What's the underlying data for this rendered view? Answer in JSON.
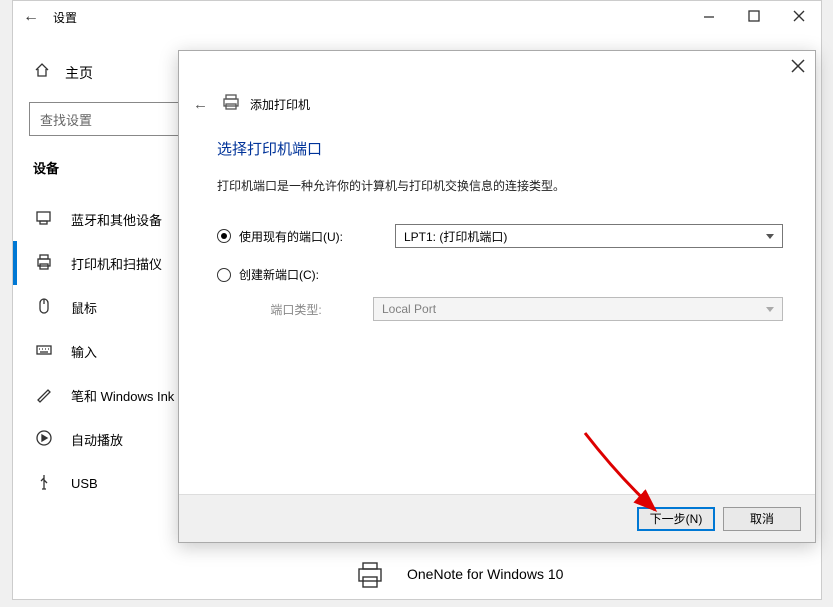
{
  "window": {
    "title": "设置",
    "back_glyph": "←"
  },
  "sidebar": {
    "home_label": "主页",
    "search_placeholder": "查找设置",
    "section": "设备",
    "items": [
      {
        "label": "蓝牙和其他设备"
      },
      {
        "label": "打印机和扫描仪"
      },
      {
        "label": "鼠标"
      },
      {
        "label": "输入"
      },
      {
        "label": "笔和 Windows Ink"
      },
      {
        "label": "自动播放"
      },
      {
        "label": "USB"
      }
    ]
  },
  "content": {
    "printer_item": "OneNote for Windows 10"
  },
  "modal": {
    "header_title": "添加打印机",
    "title": "选择打印机端口",
    "description": "打印机端口是一种允许你的计算机与打印机交换信息的连接类型。",
    "opt_existing": "使用现有的端口(U):",
    "opt_create": "创建新端口(C):",
    "port_value": "LPT1: (打印机端口)",
    "port_type_label": "端口类型:",
    "port_type_value": "Local Port",
    "next_btn": "下一步(N)",
    "cancel_btn": "取消"
  }
}
